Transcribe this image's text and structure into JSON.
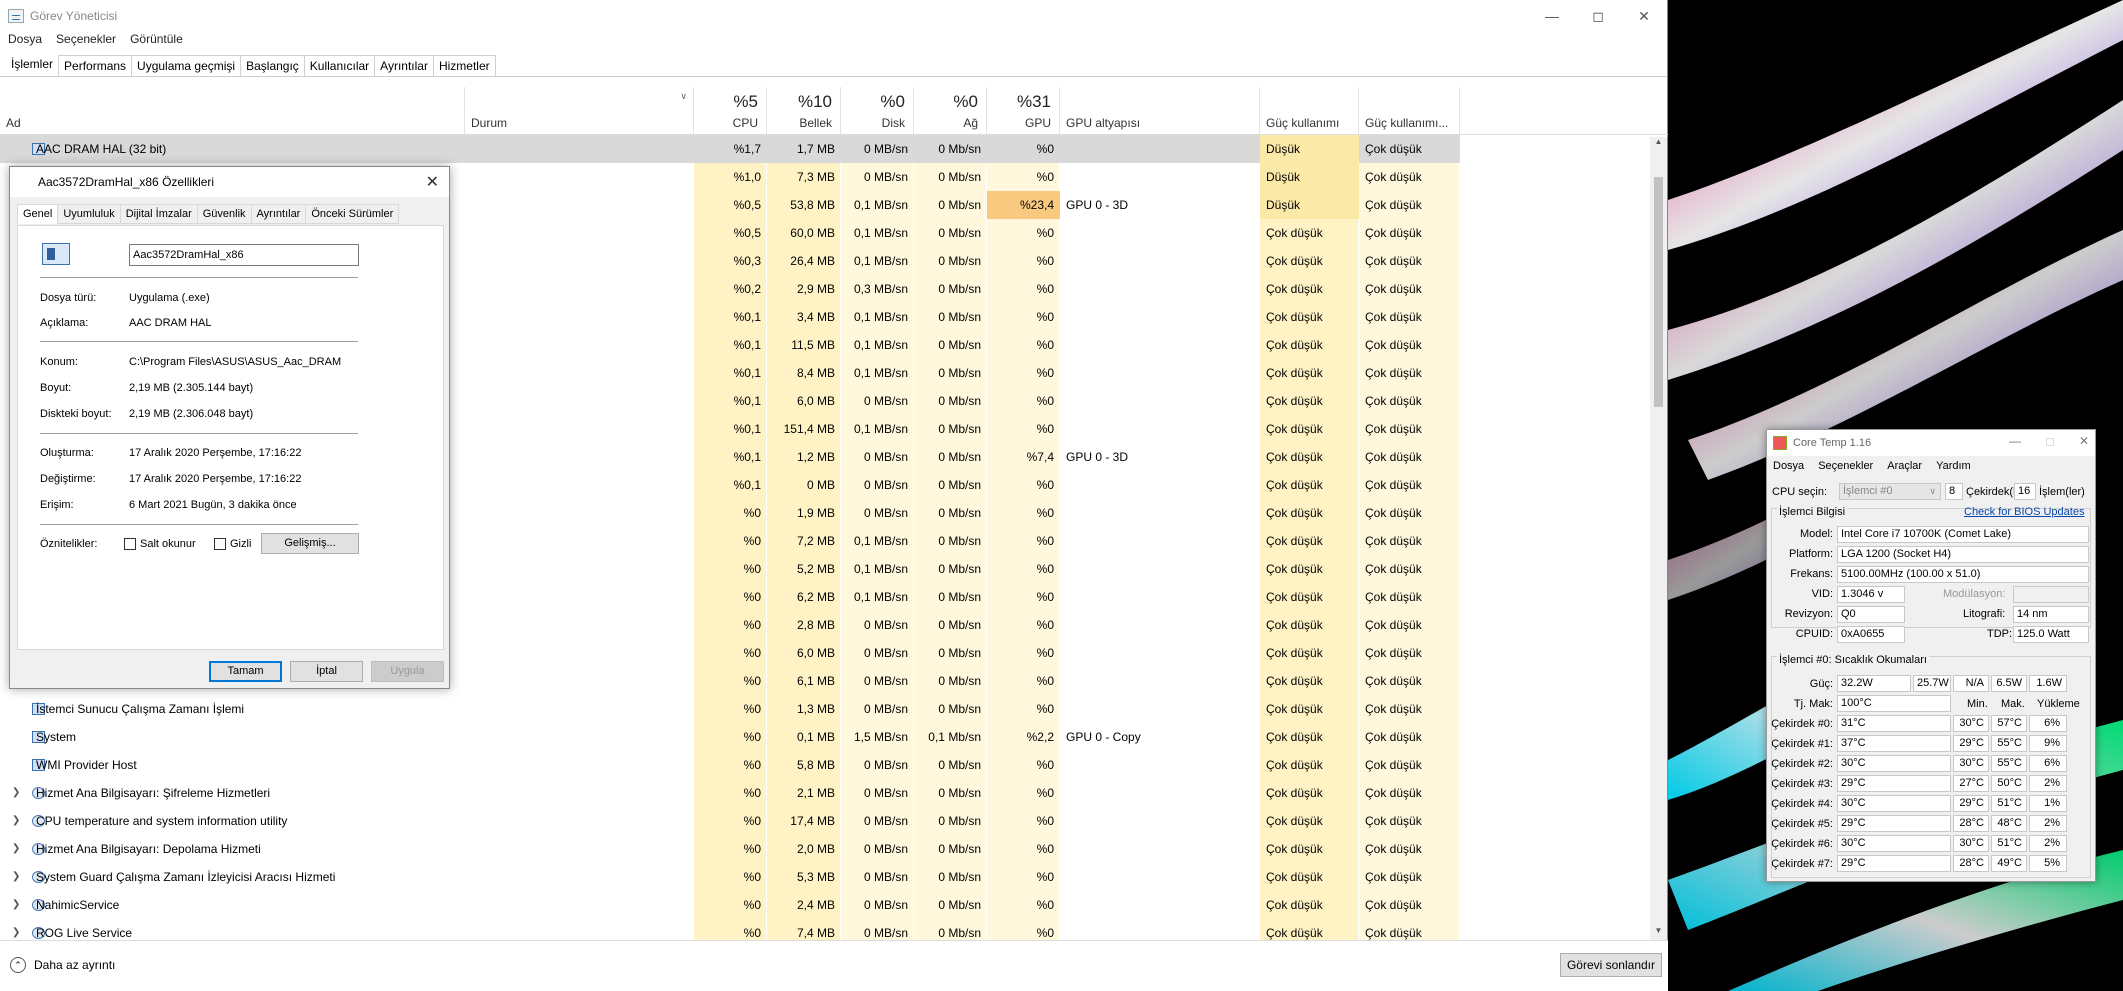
{
  "window": {
    "title": "Görev Yöneticisi",
    "menu": [
      "Dosya",
      "Seçenekler",
      "Görüntüle"
    ],
    "tabs": [
      "İşlemler",
      "Performans",
      "Uygulama geçmişi",
      "Başlangıç",
      "Kullanıcılar",
      "Ayrıntılar",
      "Hizmetler"
    ],
    "active_tab": "İşlemler"
  },
  "columns": {
    "name": "Ad",
    "status": "Durum",
    "cpu": {
      "pct": "%5",
      "label": "CPU"
    },
    "mem": {
      "pct": "%10",
      "label": "Bellek"
    },
    "disk": {
      "pct": "%0",
      "label": "Disk"
    },
    "net": {
      "pct": "%0",
      "label": "Ağ"
    },
    "gpu": {
      "pct": "%31",
      "label": "GPU"
    },
    "gpu_engine": "GPU altyapısı",
    "power": "Güç kullanımı",
    "power_trend": "Güç kullanımı..."
  },
  "rows": [
    {
      "name": "AAC DRAM HAL (32 bit)",
      "cpu": "%1,7",
      "mem": "1,7 MB",
      "disk": "0 MB/sn",
      "net": "0 Mb/sn",
      "gpu": "%0",
      "engine": "",
      "power": "Düşük",
      "trend": "Çok düşük",
      "selected": true
    },
    {
      "name": "",
      "cpu": "%1,0",
      "mem": "7,3 MB",
      "disk": "0 MB/sn",
      "net": "0 Mb/sn",
      "gpu": "%0",
      "engine": "",
      "power": "Düşük",
      "trend": "Çok düşük"
    },
    {
      "name": "",
      "cpu": "%0,5",
      "mem": "53,8 MB",
      "disk": "0,1 MB/sn",
      "net": "0 Mb/sn",
      "gpu": "%23,4",
      "engine": "GPU 0 - 3D",
      "power": "Düşük",
      "trend": "Çok düşük",
      "gpu_hl": true
    },
    {
      "name": "",
      "cpu": "%0,5",
      "mem": "60,0 MB",
      "disk": "0,1 MB/sn",
      "net": "0 Mb/sn",
      "gpu": "%0",
      "engine": "",
      "power": "Çok düşük",
      "trend": "Çok düşük"
    },
    {
      "name": "",
      "cpu": "%0,3",
      "mem": "26,4 MB",
      "disk": "0,1 MB/sn",
      "net": "0 Mb/sn",
      "gpu": "%0",
      "engine": "",
      "power": "Çok düşük",
      "trend": "Çok düşük"
    },
    {
      "name": "",
      "cpu": "%0,2",
      "mem": "2,9 MB",
      "disk": "0,3 MB/sn",
      "net": "0 Mb/sn",
      "gpu": "%0",
      "engine": "",
      "power": "Çok düşük",
      "trend": "Çok düşük"
    },
    {
      "name": "",
      "cpu": "%0,1",
      "mem": "3,4 MB",
      "disk": "0,1 MB/sn",
      "net": "0 Mb/sn",
      "gpu": "%0",
      "engine": "",
      "power": "Çok düşük",
      "trend": "Çok düşük"
    },
    {
      "name": "",
      "cpu": "%0,1",
      "mem": "11,5 MB",
      "disk": "0,1 MB/sn",
      "net": "0 Mb/sn",
      "gpu": "%0",
      "engine": "",
      "power": "Çok düşük",
      "trend": "Çok düşük"
    },
    {
      "name": "",
      "cpu": "%0,1",
      "mem": "8,4 MB",
      "disk": "0,1 MB/sn",
      "net": "0 Mb/sn",
      "gpu": "%0",
      "engine": "",
      "power": "Çok düşük",
      "trend": "Çok düşük"
    },
    {
      "name": "",
      "cpu": "%0,1",
      "mem": "6,0 MB",
      "disk": "0 MB/sn",
      "net": "0 Mb/sn",
      "gpu": "%0",
      "engine": "",
      "power": "Çok düşük",
      "trend": "Çok düşük"
    },
    {
      "name": "",
      "cpu": "%0,1",
      "mem": "151,4 MB",
      "disk": "0,1 MB/sn",
      "net": "0 Mb/sn",
      "gpu": "%0",
      "engine": "",
      "power": "Çok düşük",
      "trend": "Çok düşük"
    },
    {
      "name": "",
      "cpu": "%0,1",
      "mem": "1,2 MB",
      "disk": "0 MB/sn",
      "net": "0 Mb/sn",
      "gpu": "%7,4",
      "engine": "GPU 0 - 3D",
      "power": "Çok düşük",
      "trend": "Çok düşük"
    },
    {
      "name": "",
      "cpu": "%0,1",
      "mem": "0 MB",
      "disk": "0 MB/sn",
      "net": "0 Mb/sn",
      "gpu": "%0",
      "engine": "",
      "power": "Çok düşük",
      "trend": "Çok düşük"
    },
    {
      "name": "",
      "cpu": "%0",
      "mem": "1,9 MB",
      "disk": "0 MB/sn",
      "net": "0 Mb/sn",
      "gpu": "%0",
      "engine": "",
      "power": "Çok düşük",
      "trend": "Çok düşük"
    },
    {
      "name": "",
      "cpu": "%0",
      "mem": "7,2 MB",
      "disk": "0,1 MB/sn",
      "net": "0 Mb/sn",
      "gpu": "%0",
      "engine": "",
      "power": "Çok düşük",
      "trend": "Çok düşük"
    },
    {
      "name": "",
      "cpu": "%0",
      "mem": "5,2 MB",
      "disk": "0,1 MB/sn",
      "net": "0 Mb/sn",
      "gpu": "%0",
      "engine": "",
      "power": "Çok düşük",
      "trend": "Çok düşük"
    },
    {
      "name": "",
      "cpu": "%0",
      "mem": "6,2 MB",
      "disk": "0,1 MB/sn",
      "net": "0 Mb/sn",
      "gpu": "%0",
      "engine": "",
      "power": "Çok düşük",
      "trend": "Çok düşük"
    },
    {
      "name": "",
      "cpu": "%0",
      "mem": "2,8 MB",
      "disk": "0 MB/sn",
      "net": "0 Mb/sn",
      "gpu": "%0",
      "engine": "",
      "power": "Çok düşük",
      "trend": "Çok düşük"
    },
    {
      "name": "",
      "cpu": "%0",
      "mem": "6,0 MB",
      "disk": "0 MB/sn",
      "net": "0 Mb/sn",
      "gpu": "%0",
      "engine": "",
      "power": "Çok düşük",
      "trend": "Çok düşük"
    },
    {
      "name": "",
      "cpu": "%0",
      "mem": "6,1 MB",
      "disk": "0 MB/sn",
      "net": "0 Mb/sn",
      "gpu": "%0",
      "engine": "",
      "power": "Çok düşük",
      "trend": "Çok düşük"
    },
    {
      "name": "İstemci Sunucu Çalışma Zamanı İşlemi",
      "cpu": "%0",
      "mem": "1,3 MB",
      "disk": "0 MB/sn",
      "net": "0 Mb/sn",
      "gpu": "%0",
      "engine": "",
      "power": "Çok düşük",
      "trend": "Çok düşük"
    },
    {
      "name": "System",
      "cpu": "%0",
      "mem": "0,1 MB",
      "disk": "1,5 MB/sn",
      "net": "0,1 Mb/sn",
      "gpu": "%2,2",
      "engine": "GPU 0 - Copy",
      "power": "Çok düşük",
      "trend": "Çok düşük"
    },
    {
      "name": "WMI Provider Host",
      "cpu": "%0",
      "mem": "5,8 MB",
      "disk": "0 MB/sn",
      "net": "0 Mb/sn",
      "gpu": "%0",
      "engine": "",
      "power": "Çok düşük",
      "trend": "Çok düşük"
    },
    {
      "name": "Hizmet Ana Bilgisayarı: Şifreleme Hizmetleri",
      "cpu": "%0",
      "mem": "2,1 MB",
      "disk": "0 MB/sn",
      "net": "0 Mb/sn",
      "gpu": "%0",
      "engine": "",
      "power": "Çok düşük",
      "trend": "Çok düşük",
      "expand": true
    },
    {
      "name": "CPU temperature and system information utility",
      "cpu": "%0",
      "mem": "17,4 MB",
      "disk": "0 MB/sn",
      "net": "0 Mb/sn",
      "gpu": "%0",
      "engine": "",
      "power": "Çok düşük",
      "trend": "Çok düşük",
      "expand": true
    },
    {
      "name": "Hizmet Ana Bilgisayarı: Depolama Hizmeti",
      "cpu": "%0",
      "mem": "2,0 MB",
      "disk": "0 MB/sn",
      "net": "0 Mb/sn",
      "gpu": "%0",
      "engine": "",
      "power": "Çok düşük",
      "trend": "Çok düşük",
      "expand": true
    },
    {
      "name": "System Guard Çalışma Zamanı İzleyicisi Aracısı Hizmeti",
      "cpu": "%0",
      "mem": "5,3 MB",
      "disk": "0 MB/sn",
      "net": "0 Mb/sn",
      "gpu": "%0",
      "engine": "",
      "power": "Çok düşük",
      "trend": "Çok düşük",
      "expand": true
    },
    {
      "name": "NahimicService",
      "cpu": "%0",
      "mem": "2,4 MB",
      "disk": "0 MB/sn",
      "net": "0 Mb/sn",
      "gpu": "%0",
      "engine": "",
      "power": "Çok düşük",
      "trend": "Çok düşük",
      "expand": true
    },
    {
      "name": "ROG Live Service",
      "cpu": "%0",
      "mem": "7,4 MB",
      "disk": "0 MB/sn",
      "net": "0 Mb/sn",
      "gpu": "%0",
      "engine": "",
      "power": "Çok düşük",
      "trend": "Çok düşük",
      "expand": true
    }
  ],
  "footer": {
    "fewer_details": "Daha az ayrıntı",
    "end_task": "Görevi sonlandır"
  },
  "props": {
    "title": "Aac3572DramHal_x86 Özellikleri",
    "tabs": [
      "Genel",
      "Uyumluluk",
      "Dijital İmzalar",
      "Güvenlik",
      "Ayrıntılar",
      "Önceki Sürümler"
    ],
    "name_value": "Aac3572DramHal_x86",
    "file_type_label": "Dosya türü:",
    "file_type": "Uygulama (.exe)",
    "desc_label": "Açıklama:",
    "desc": "AAC DRAM HAL",
    "location_label": "Konum:",
    "location": "C:\\Program Files\\ASUS\\ASUS_Aac_DRAM",
    "size_label": "Boyut:",
    "size": "2,19 MB (2.305.144 bayt)",
    "disk_size_label": "Diskteki boyut:",
    "disk_size": "2,19 MB (2.306.048 bayt)",
    "created_label": "Oluşturma:",
    "created": "17 Aralık 2020 Perşembe, 17:16:22",
    "modified_label": "Değiştirme:",
    "modified": "17 Aralık 2020 Perşembe, 17:16:22",
    "accessed_label": "Erişim:",
    "accessed": "6 Mart 2021 Bugün, 3 dakika önce",
    "attrs_label": "Öznitelikler:",
    "readonly": "Salt okunur",
    "hidden": "Gizli",
    "advanced": "Gelişmiş...",
    "ok": "Tamam",
    "cancel": "İptal",
    "apply": "Uygula"
  },
  "coretemp": {
    "title": "Core Temp 1.16",
    "menu": [
      "Dosya",
      "Seçenekler",
      "Araçlar",
      "Yardım"
    ],
    "cpu_select_label": "CPU seçin:",
    "cpu_select": "İşlemci #0",
    "cores_val": "8",
    "cores_label": "Çekirdek(le",
    "threads_val": "16",
    "threads_label": "İşlem(ler)",
    "proc_info": "İşlemci Bilgisi",
    "bios_link": "Check for BIOS Updates",
    "model_label": "Model:",
    "model": "Intel Core i7 10700K (Comet Lake)",
    "platform_label": "Platform:",
    "platform": "LGA 1200 (Socket H4)",
    "freq_label": "Frekans:",
    "freq": "5100.00MHz (100.00 x 51.0)",
    "vid_label": "VID:",
    "vid": "1.3046 v",
    "mod_label": "Modülasyon:",
    "rev_label": "Revizyon:",
    "rev": "Q0",
    "litho_label": "Litografi:",
    "litho": "14 nm",
    "cpuid_label": "CPUID:",
    "cpuid": "0xA0655",
    "tdp_label": "TDP:",
    "tdp": "125.0 Watt",
    "temps_title": "İşlemci #0: Sıcaklık Okumaları",
    "power_label": "Güç:",
    "power": [
      "32.2W",
      "25.7W",
      "N/A",
      "6.5W",
      "1.6W"
    ],
    "tjmax_label": "Tj. Mak:",
    "tjmax": "100°C",
    "min_h": "Min.",
    "max_h": "Mak.",
    "load_h": "Yükleme",
    "cores": [
      {
        "label": "Çekirdek #0:",
        "t": "31°C",
        "min": "30°C",
        "max": "57°C",
        "load": "6%"
      },
      {
        "label": "Çekirdek #1:",
        "t": "37°C",
        "min": "29°C",
        "max": "55°C",
        "load": "9%"
      },
      {
        "label": "Çekirdek #2:",
        "t": "30°C",
        "min": "30°C",
        "max": "55°C",
        "load": "6%"
      },
      {
        "label": "Çekirdek #3:",
        "t": "29°C",
        "min": "27°C",
        "max": "50°C",
        "load": "2%"
      },
      {
        "label": "Çekirdek #4:",
        "t": "30°C",
        "min": "29°C",
        "max": "51°C",
        "load": "1%"
      },
      {
        "label": "Çekirdek #5:",
        "t": "29°C",
        "min": "28°C",
        "max": "48°C",
        "load": "2%"
      },
      {
        "label": "Çekirdek #6:",
        "t": "30°C",
        "min": "30°C",
        "max": "51°C",
        "load": "2%"
      },
      {
        "label": "Çekirdek #7:",
        "t": "29°C",
        "min": "28°C",
        "max": "49°C",
        "load": "5%"
      }
    ]
  }
}
